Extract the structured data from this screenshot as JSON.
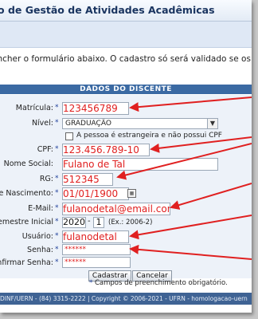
{
  "header": {
    "title": "o de Gestão de Atividades Acadêmicas"
  },
  "intro_text": "encher o formulário abaixo. O cadastro só será validado se os dados digitados fo",
  "form": {
    "section_title": "DADOS DO DISCENTE",
    "required_marker": "*",
    "matricula": {
      "label": "Matrícula:",
      "value": "123456789"
    },
    "nivel": {
      "label": "Nível:",
      "value": "GRADUAÇÃO"
    },
    "foreign_checkbox": {
      "label": "A pessoa é estrangeira e não possui CPF",
      "checked": false
    },
    "cpf": {
      "label": "CPF:",
      "value": "123.456.789-10"
    },
    "nome_social": {
      "label": "Nome Social:",
      "value": "Fulano de Tal"
    },
    "rg": {
      "label": "RG:",
      "value": "512345"
    },
    "nascimento": {
      "label": "a de Nascimento:",
      "value": "01/01/1900"
    },
    "email": {
      "label": "E-Mail:",
      "value": "fulanodetal@email.com"
    },
    "ano_semestre": {
      "label": "/Semestre Inicial",
      "year": "2020",
      "semester": "1",
      "hint": "(Ex.: 2006-2)"
    },
    "usuario": {
      "label": "Usuário:",
      "value": "fulanodetal"
    },
    "senha": {
      "label": "Senha:",
      "value": "******"
    },
    "confirmar_senha": {
      "label": "onfirmar Senha:",
      "value": "******"
    },
    "buttons": {
      "register": "Cadastrar",
      "cancel": "Cancelar"
    },
    "required_note": "Campos de preenchimento obrigatório."
  },
  "footer": {
    "text": "DINF/UERN - (84) 3315-2222 | Copyright © 2006-2021 - UFRN - homologacao-uern"
  },
  "colors": {
    "header_band": "#3b6aa3",
    "form_bg": "#edf2f9",
    "annotation": "#e02020",
    "footer": "#3f6394"
  }
}
